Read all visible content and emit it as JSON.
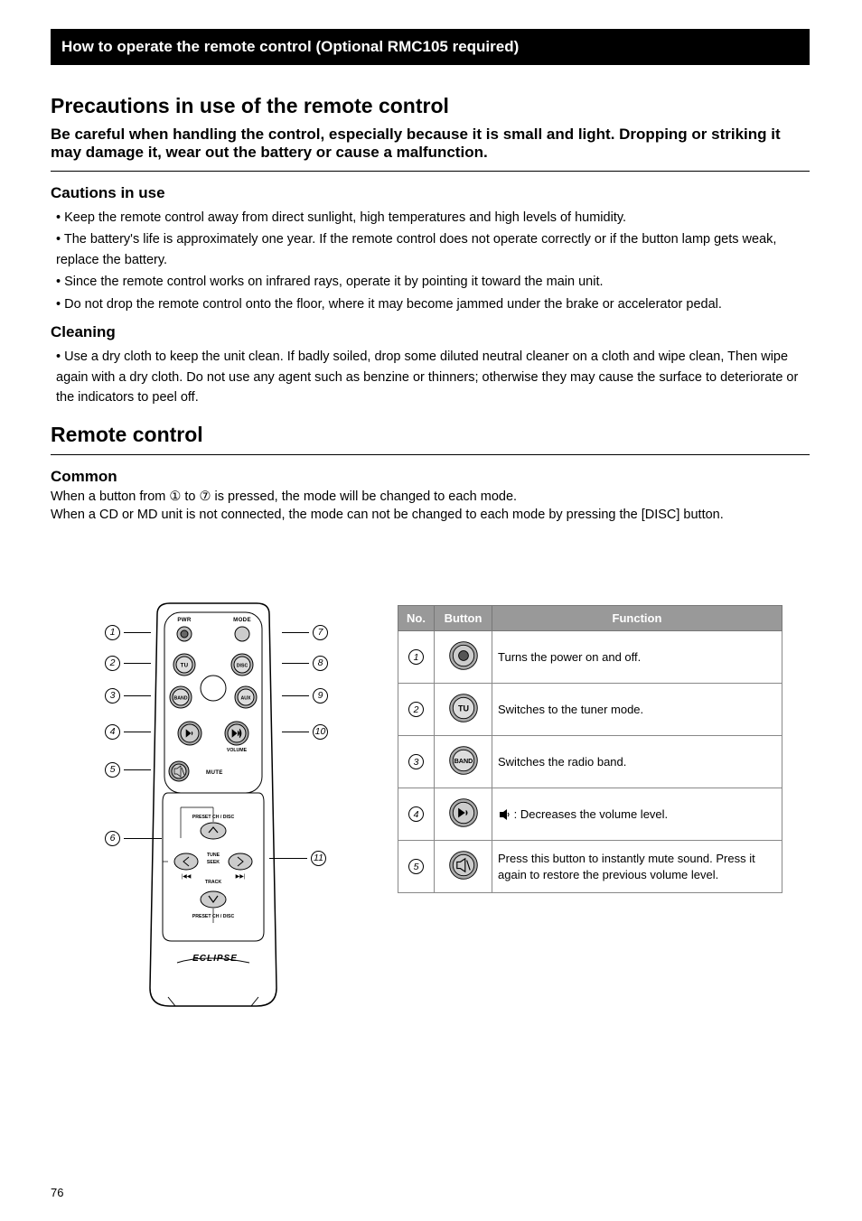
{
  "header": "How to operate the remote control (Optional RMC105 required)",
  "section1": {
    "title": "Precautions in use of the remote control",
    "subtitle": "Be careful when handling the control, especially because it is small and light. Dropping or striking it may damage it, wear out the battery or cause a malfunction.",
    "sub1": {
      "head": "Cautions in use",
      "bullets": [
        "• Keep the remote control away from direct sunlight, high temperatures and high levels of humidity.",
        "• The battery's life is approximately one year. If the remote control does not operate correctly or if the button lamp gets weak, replace the battery.",
        "• Since the remote control works on infrared rays, operate it by pointing it toward the main unit.",
        "• Do not drop the remote control onto the floor, where it may become jammed under the brake or accelerator pedal."
      ]
    },
    "sub2": {
      "head": "Cleaning",
      "bullets": [
        "• Use a dry cloth to keep the unit clean. If badly soiled, drop some diluted neutral cleaner on a cloth and wipe clean, Then wipe again with a dry cloth. Do not use any agent such as benzine or thinners; otherwise they may cause the surface to deteriorate or the indicators to peel off."
      ]
    }
  },
  "section2": {
    "title": "Remote control",
    "subtitle": "Common",
    "intro": "When a button from ① to ⑦ is pressed, the mode will be changed to each mode.",
    "intro2": "When a CD or MD unit is not connected, the mode can not be changed to each mode by pressing the [DISC] button.",
    "table": {
      "headers": [
        "No.",
        "Button",
        "Function"
      ],
      "rows": [
        {
          "num": "1",
          "fn": "Turns the power on and off."
        },
        {
          "num": "2",
          "fn": "Switches to the tuner mode."
        },
        {
          "num": "3",
          "fn": "Switches the radio band."
        },
        {
          "num": "4",
          "fn": "        : Decreases the volume level."
        },
        {
          "num": "5",
          "fn": "Press this button to instantly mute sound. Press it again to restore the previous volume level."
        }
      ]
    }
  },
  "remote": {
    "labels": {
      "pwr": "PWR",
      "mode": "MODE",
      "tu": "TU",
      "disc": "DISC",
      "band": "BAND",
      "aux": "AUX",
      "mute": "MUTE",
      "volume": "VOLUME",
      "preset_top": "PRESET CH / DISC",
      "tune_seek": "TUNE\nSEEK",
      "track": "TRACK",
      "preset_bot": "PRESET CH / DISC",
      "logo": "ECLIPSE"
    },
    "callouts_left": [
      "1",
      "2",
      "3",
      "4",
      "5",
      "6"
    ],
    "callouts_right": [
      "7",
      "8",
      "9",
      "10",
      "11"
    ]
  },
  "page": "76"
}
